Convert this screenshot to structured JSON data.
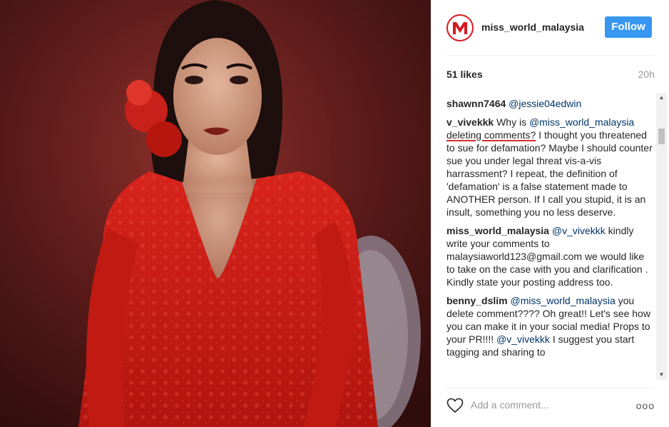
{
  "post": {
    "username": "miss_world_malaysia",
    "follow_label": "Follow",
    "likes": "51 likes",
    "time": "20h"
  },
  "comments": [
    {
      "author": "shawnn7464",
      "segments": [
        {
          "t": "@jessie04edwin",
          "k": "mention"
        }
      ]
    },
    {
      "author": "v_vivekkk",
      "segments": [
        {
          "t": "Why is ",
          "k": "text"
        },
        {
          "t": "@miss_world_malaysia",
          "k": "mention"
        },
        {
          "t": " ",
          "k": "text"
        },
        {
          "t": "deleting comments?",
          "k": "underline"
        },
        {
          "t": " I thought you threatened to sue for defamation? Maybe I should counter sue you under legal threat vis-a-vis harrassment? I repeat, the definition of 'defamation' is a false statement made to ANOTHER person. If I call you stupid, it is an insult, something you no less deserve.",
          "k": "text"
        }
      ]
    },
    {
      "author": "miss_world_malaysia",
      "segments": [
        {
          "t": "@v_vivekkk",
          "k": "mention"
        },
        {
          "t": " kindly write your comments to malaysiaworld123@gmail.com we would like to take on the case with you and clarification . Kindly state your posting address too.",
          "k": "text"
        }
      ]
    },
    {
      "author": "benny_dslim",
      "segments": [
        {
          "t": "@miss_world_malaysia",
          "k": "mention"
        },
        {
          "t": " you delete comment???? Oh great!! Let's see how you can make it in your social media! Props to your PR!!!! ",
          "k": "text"
        },
        {
          "t": "@v_vivekkk",
          "k": "mention"
        },
        {
          "t": " I suggest you start tagging and sharing to",
          "k": "text"
        }
      ]
    }
  ],
  "footer": {
    "add_comment_placeholder": "Add a comment...",
    "more_label": "ooo"
  },
  "icons": {
    "like": "heart-outline-icon",
    "more": "ellipsis-icon",
    "avatar": "miss-world-logo"
  },
  "colors": {
    "follow_button": "#3897f0",
    "mention": "#003569",
    "underline": "#d32f2f",
    "brand_red": "#d71920"
  }
}
